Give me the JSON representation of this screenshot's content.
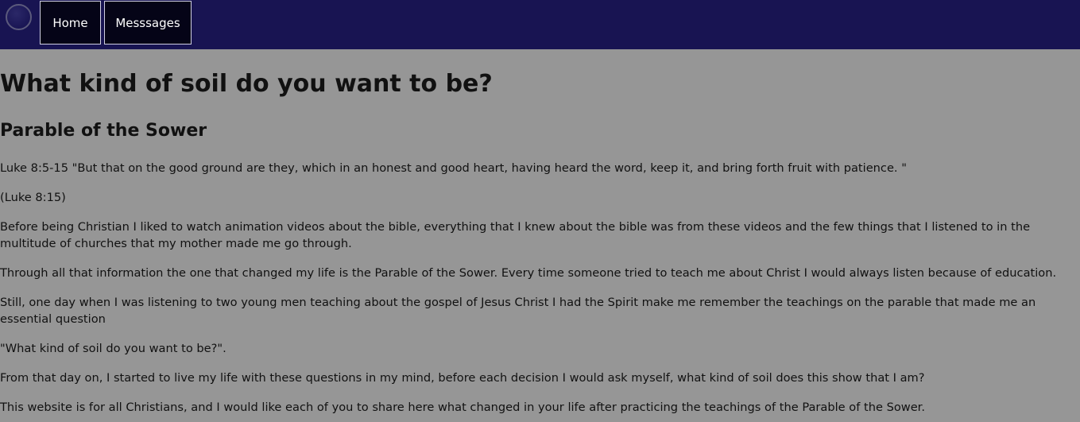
{
  "nav": {
    "logo_icon": "circle-logo-icon",
    "items": [
      "Home",
      "Messsages"
    ]
  },
  "page": {
    "title": "What kind of soil do you want to be?",
    "subtitle": "Parable of the Sower",
    "paragraphs": [
      "Luke 8:5-15 \"But that on the good ground are they, which in an honest and good heart, having heard the word, keep it, and bring forth fruit with patience. \"",
      "(Luke 8:15)",
      "Before being Christian I liked to watch animation videos about the bible, everything that I knew about the bible was from these videos and the few things that I listened to in the multitude of churches that my mother made me go through.",
      "Through all that information the one that changed my life is the Parable of the Sower. Every time someone tried to teach me about Christ I would always listen because of education.",
      "Still, one day when I was listening to two young men teaching about the gospel of Jesus Christ I had the Spirit make me remember the teachings on the parable that made me an essential question",
      "\"What kind of soil do you want to be?\".",
      "From that day on, I started to live my life with these questions in my mind, before each decision I would ask myself, what kind of soil does this show that I am?",
      "This website is for all Christians, and I would like each of you to share here what changed in your life after practicing the teachings of the Parable of the Sower."
    ]
  },
  "colors": {
    "nav_background": "#181452",
    "page_background": "#969696",
    "button_background": "#050417"
  }
}
